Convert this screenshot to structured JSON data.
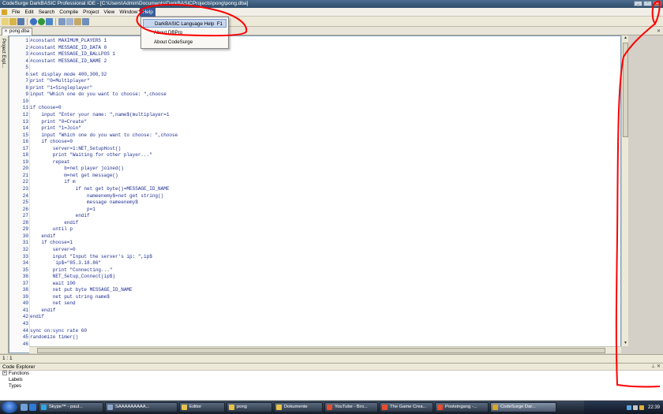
{
  "window": {
    "title": "CodeSurge DarkBASIC Professional IDE - [C:\\Users\\Admin\\Documents\\DarkBASICProjects\\pong\\pong.dba]"
  },
  "menubar": {
    "items": [
      "File",
      "Edit",
      "Search",
      "Compile",
      "Project",
      "View",
      "Window",
      "Help"
    ]
  },
  "help_menu": {
    "items": [
      {
        "label": "DarkBASIC Language Help",
        "shortcut": "F1"
      },
      {
        "label": "About DBPro",
        "shortcut": ""
      },
      {
        "label": "About CodeSurge",
        "shortcut": ""
      }
    ]
  },
  "tab": {
    "label": "pong.dba"
  },
  "side_panel": {
    "label": "Project Expl..."
  },
  "editor": {
    "lines": [
      "#constant MAXIMUM_PLAYERS 1",
      "#constant MESSAGE_ID_DATA 0",
      "#constant MESSAGE_ID_BALLPOS 1",
      "#constant MESSAGE_ID_NAME 2",
      "",
      "set display mode 400,300,32",
      "print \"0=Multiplayer\"",
      "print \"1=Singleplayer\"",
      "input \"Which one do you want to choose: \",choose",
      "",
      "if choose=0",
      "    input \"Enter your name: \",name$(multiplayer=1",
      "    print \"0=Create\"",
      "    print \"1=Join\"",
      "    input \"Which one do you want to choose: \",choose",
      "    if choose=0",
      "        server=1:NET_SetupHost()",
      "        print \"Waiting for other player...\"",
      "        repeat",
      "            b=net player joined()",
      "            m=net get message()",
      "            if m",
      "                if net get byte()=MESSAGE_ID_NAME",
      "                    nameenemy$=net get string()",
      "                    message nameenemy$",
      "                    p=1",
      "                endif",
      "            endif",
      "        until p",
      "    endif",
      "    if choose=1",
      "        server=0",
      "        input \"Input the server's ip: \",ip$",
      "        `ip$=\"85.3.18.86\"",
      "        print \"Connecting...\"",
      "        NET_Setup_Connect(ip$)",
      "        wait 100",
      "        net put byte MESSAGE_ID_NAME",
      "        net put string name$",
      "        net send",
      "    endif",
      "endif",
      "",
      "sync on:sync rate 60",
      "randomize timer()",
      ""
    ]
  },
  "statusbar": {
    "position": "1 : 1"
  },
  "code_explorer": {
    "title": "Code Explorer",
    "items": [
      "Functions",
      "Labels",
      "Types"
    ]
  },
  "taskbar": {
    "tasks": [
      {
        "label": "Skype™ - paul...",
        "color": "#2fa4e0"
      },
      {
        "label": "SAAAAAAAAA...",
        "color": "#8aa4c8"
      },
      {
        "label": "Editor",
        "color": "#e6c34a"
      },
      {
        "label": "pong",
        "color": "#e6c34a"
      },
      {
        "label": "Dokumente",
        "color": "#e6c34a"
      },
      {
        "label": "YouTube - Bro...",
        "color": "#e44d2e"
      },
      {
        "label": "The Game Crea...",
        "color": "#e44d2e"
      },
      {
        "label": "Posteingang -...",
        "color": "#e44d2e"
      },
      {
        "label": "CodeSurge Dar...",
        "color": "#d8a62a"
      }
    ],
    "clock": "22:39"
  },
  "colors": {
    "annotation": "#ff0000",
    "code_text": "#1f2f8f",
    "menu_highlight": "#c6d6ee"
  }
}
